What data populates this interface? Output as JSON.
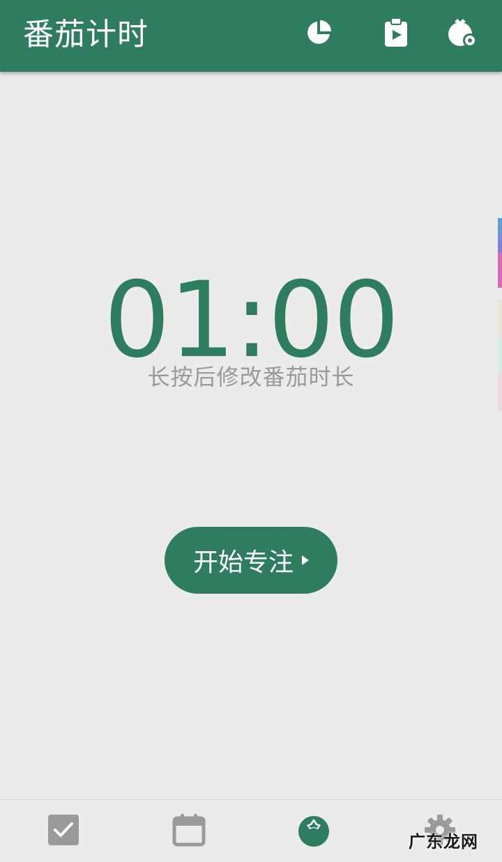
{
  "app": {
    "title": "番茄计时"
  },
  "toolbar": {
    "actions": [
      {
        "icon": "pie-chart-icon"
      },
      {
        "icon": "clipboard-play-icon"
      },
      {
        "icon": "timer-settings-icon"
      }
    ]
  },
  "timer": {
    "time": "01:00",
    "hint": "长按后修改番茄时长"
  },
  "start_button": {
    "label": "开始专注"
  },
  "bottom_nav": {
    "items": [
      {
        "icon": "checkbox-icon"
      },
      {
        "icon": "calendar-icon"
      },
      {
        "icon": "tomato-icon",
        "active": true
      },
      {
        "icon": "gear-icon"
      }
    ]
  },
  "watermark": {
    "text": "广东龙网"
  },
  "colors": {
    "primary": "#2e7d5e",
    "background": "#ebebeb",
    "hint_text": "#9a9a9a",
    "inactive_icon": "#9a9a9a"
  }
}
